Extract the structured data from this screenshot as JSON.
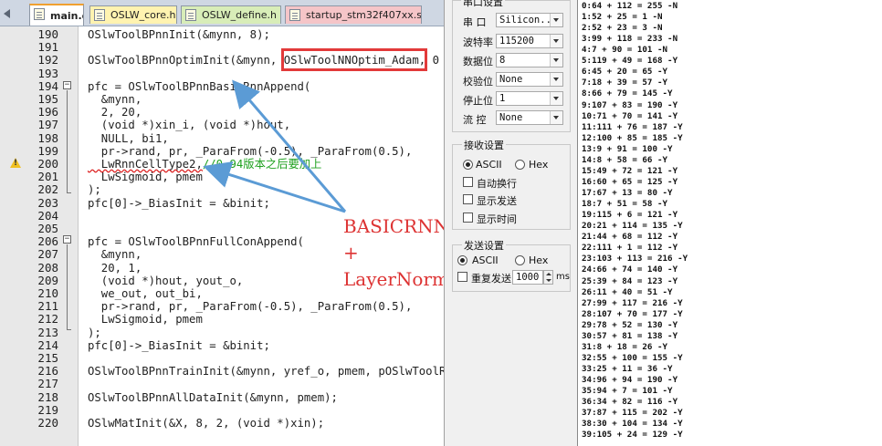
{
  "editor": {
    "tabs": [
      {
        "label": "main.c"
      },
      {
        "label": "OSLW_core.h"
      },
      {
        "label": "OSLW_define.h"
      },
      {
        "label": "startup_stm32f407xx.s"
      }
    ],
    "lines": [
      {
        "num": "190",
        "text": "OSlwToolBPnnInit(&mynn, 8);"
      },
      {
        "num": "191",
        "text": ""
      },
      {
        "num": "192",
        "text": "OSlwToolBPnnOptimInit(&mynn, OSlwToolNNOptim_Adam, 0"
      },
      {
        "num": "193",
        "text": ""
      },
      {
        "num": "194",
        "text": "pfc = OSlwToolBPnnBasicRnnAppend("
      },
      {
        "num": "195",
        "text": "  &mynn,"
      },
      {
        "num": "196",
        "text": "  2, 20,"
      },
      {
        "num": "197",
        "text": "  (void *)xin_i, (void *)hout,"
      },
      {
        "num": "198",
        "text": "  NULL, bi1,"
      },
      {
        "num": "199",
        "text": "  pr->rand, pr, _ParaFrom(-0.5), _ParaFrom(0.5),"
      },
      {
        "num": "200",
        "text": "  LwRnnCellType2,",
        "comment": "//0.94版本之后要加上"
      },
      {
        "num": "201",
        "text": "  LwSigmoid, pmem"
      },
      {
        "num": "202",
        "text": ");"
      },
      {
        "num": "203",
        "text": "pfc[0]->_BiasInit = &binit;"
      },
      {
        "num": "204",
        "text": ""
      },
      {
        "num": "205",
        "text": ""
      },
      {
        "num": "206",
        "text": "pfc = OSlwToolBPnnFullConAppend("
      },
      {
        "num": "207",
        "text": "  &mynn,"
      },
      {
        "num": "208",
        "text": "  20, 1,"
      },
      {
        "num": "209",
        "text": "  (void *)hout, yout_o,"
      },
      {
        "num": "210",
        "text": "  we_out, out_bi,"
      },
      {
        "num": "211",
        "text": "  pr->rand, pr, _ParaFrom(-0.5), _ParaFrom(0.5),"
      },
      {
        "num": "212",
        "text": "  LwSigmoid, pmem"
      },
      {
        "num": "213",
        "text": ");"
      },
      {
        "num": "214",
        "text": "pfc[0]->_BiasInit = &binit;"
      },
      {
        "num": "215",
        "text": ""
      },
      {
        "num": "216",
        "text": "OSlwToolBPnnTrainInit(&mynn, yref_o, pmem, pOSlwToolR"
      },
      {
        "num": "217",
        "text": ""
      },
      {
        "num": "218",
        "text": "OSlwToolBPnnAllDataInit(&mynn, pmem);"
      },
      {
        "num": "219",
        "text": ""
      },
      {
        "num": "220",
        "text": "OSlwMatInit(&X, 8, 2, (void *)xin);"
      }
    ],
    "annotation": {
      "line1": "BASICRNN",
      "line2": "+",
      "line3": "LayerNorm"
    },
    "colors": {
      "annotation": "#d33333",
      "highlight_box": "#e23a3a",
      "arrow": "#5b9bd5",
      "comment": "#1fa11f"
    }
  },
  "serial": {
    "top_group_title": "串口设置",
    "fields": [
      {
        "label": "串  口",
        "value": "Silicon..."
      },
      {
        "label": "波特率",
        "value": "115200"
      },
      {
        "label": "数据位",
        "value": "8"
      },
      {
        "label": "校验位",
        "value": "None"
      },
      {
        "label": "停止位",
        "value": "1"
      },
      {
        "label": "流  控",
        "value": "None"
      }
    ],
    "receive": {
      "title": "接收设置",
      "ascii": "ASCII",
      "hex": "Hex",
      "options": [
        "自动换行",
        "显示发送",
        "显示时间"
      ]
    },
    "send": {
      "title": "发送设置",
      "ascii": "ASCII",
      "hex": "Hex",
      "repeat_label": "重复发送",
      "repeat_value": "1000",
      "unit": "ms"
    }
  },
  "output": {
    "lines": [
      "0:64 + 112 = 255 -N",
      "1:52 + 25 = 1 -N",
      "2:52 + 23 = 3 -N",
      "3:99 + 118 = 233 -N",
      "4:7 + 90 = 101 -N",
      "5:119 + 49 = 168 -Y",
      "6:45 + 20 = 65 -Y",
      "7:18 + 39 = 57 -Y",
      "8:66 + 79 = 145 -Y",
      "9:107 + 83 = 190 -Y",
      "10:71 + 70 = 141 -Y",
      "11:111 + 76 = 187 -Y",
      "12:100 + 85 = 185 -Y",
      "13:9 + 91 = 100 -Y",
      "14:8 + 58 = 66 -Y",
      "15:49 + 72 = 121 -Y",
      "16:60 + 65 = 125 -Y",
      "17:67 + 13 = 80 -Y",
      "18:7 + 51 = 58 -Y",
      "19:115 + 6 = 121 -Y",
      "20:21 + 114 = 135 -Y",
      "21:44 + 68 = 112 -Y",
      "22:111 + 1 = 112 -Y",
      "23:103 + 113 = 216 -Y",
      "24:66 + 74 = 140 -Y",
      "25:39 + 84 = 123 -Y",
      "26:11 + 40 = 51 -Y",
      "27:99 + 117 = 216 -Y",
      "28:107 + 70 = 177 -Y",
      "29:78 + 52 = 130 -Y",
      "30:57 + 81 = 138 -Y",
      "31:8 + 18 = 26 -Y",
      "32:55 + 100 = 155 -Y",
      "33:25 + 11 = 36 -Y",
      "34:96 + 94 = 190 -Y",
      "35:94 + 7 = 101 -Y",
      "36:34 + 82 = 116 -Y",
      "37:87 + 115 = 202 -Y",
      "38:30 + 104 = 134 -Y",
      "39:105 + 24 = 129 -Y"
    ]
  }
}
